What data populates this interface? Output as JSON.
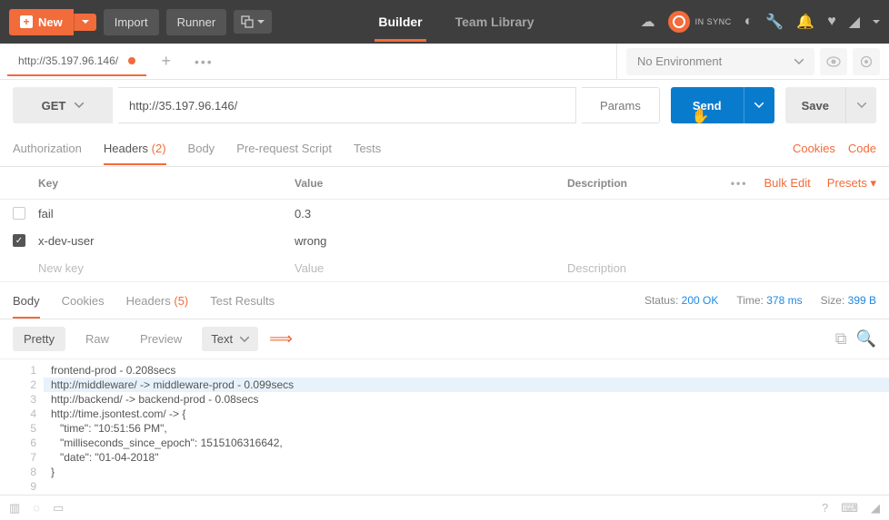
{
  "topbar": {
    "new_label": "New",
    "import_label": "Import",
    "runner_label": "Runner",
    "builder_label": "Builder",
    "team_library_label": "Team Library",
    "sync_label": "IN SYNC"
  },
  "request_tab": {
    "title": "http://35.197.96.146/"
  },
  "env": {
    "selected": "No Environment"
  },
  "request": {
    "method": "GET",
    "url": "http://35.197.96.146/",
    "params_label": "Params",
    "send_label": "Send",
    "save_label": "Save"
  },
  "subtabs": {
    "authorization": "Authorization",
    "headers": "Headers",
    "headers_count": "(2)",
    "body": "Body",
    "prerequest": "Pre-request Script",
    "tests": "Tests",
    "cookies": "Cookies",
    "code": "Code"
  },
  "headers_table": {
    "col_key": "Key",
    "col_value": "Value",
    "col_desc": "Description",
    "bulk_edit": "Bulk Edit",
    "presets": "Presets ▾",
    "rows": [
      {
        "checked": false,
        "key": "fail",
        "value": "0.3",
        "desc": ""
      },
      {
        "checked": true,
        "key": "x-dev-user",
        "value": "wrong",
        "desc": ""
      }
    ],
    "placeholder": {
      "key": "New key",
      "value": "Value",
      "desc": "Description"
    }
  },
  "response_tabs": {
    "body": "Body",
    "cookies": "Cookies",
    "headers": "Headers",
    "headers_count": "(5)",
    "test_results": "Test Results"
  },
  "response_meta": {
    "status_label": "Status:",
    "status_value": "200 OK",
    "status_color": "green",
    "time_label": "Time:",
    "time_value": "378 ms",
    "size_label": "Size:",
    "size_value": "399 B"
  },
  "viewbar": {
    "pretty": "Pretty",
    "raw": "Raw",
    "preview": "Preview",
    "mode": "Text"
  },
  "chart_data": {
    "type": "table",
    "response_body_lines": [
      "frontend-prod - 0.208secs",
      "http://middleware/ -> middleware-prod - 0.099secs",
      "http://backend/ -> backend-prod - 0.08secs",
      "http://time.jsontest.com/ -> {",
      "   \"time\": \"10:51:56 PM\",",
      "   \"milliseconds_since_epoch\": 1515106316642,",
      "   \"date\": \"01-04-2018\"",
      "}",
      ""
    ],
    "highlighted_line": 2
  }
}
